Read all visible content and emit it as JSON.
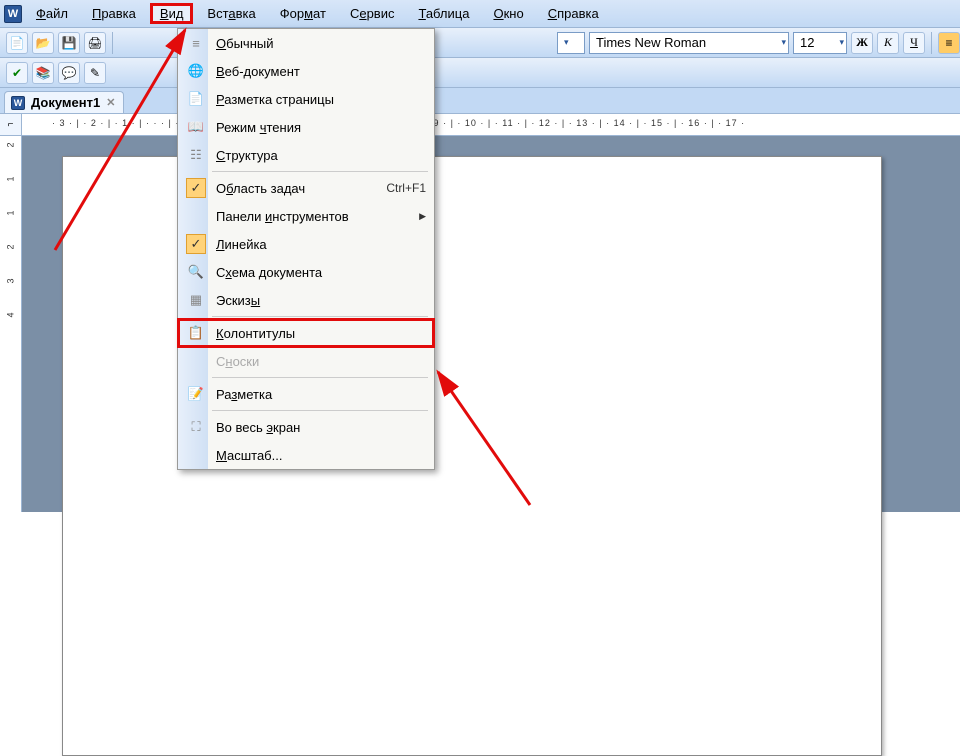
{
  "menubar": {
    "items": [
      {
        "label": "Файл",
        "u": "Ф"
      },
      {
        "label": "Правка",
        "u": "П"
      },
      {
        "label": "Вид",
        "u": "В",
        "highlighted": true
      },
      {
        "label": "Вставка",
        "u": "а"
      },
      {
        "label": "Формат",
        "u": "м"
      },
      {
        "label": "Сервис",
        "u": "е"
      },
      {
        "label": "Таблица",
        "u": "Т"
      },
      {
        "label": "Окно",
        "u": "О"
      },
      {
        "label": "Справка",
        "u": "С"
      }
    ]
  },
  "toolbar": {
    "font_name": "Times New Roman",
    "font_size": "12",
    "bold": "Ж",
    "italic": "К",
    "underline": "Ч"
  },
  "doc_tab": {
    "label": "Документ1"
  },
  "ruler_h": "· 3 · | · 2 · | · 1 · | · · · | · 1 · | · 2 · | · 3 · | · 4 · |                          · 5 · | · 6 · | · 7 · | · 8 · | · 9 · | · 10 · | · 11 · | · 12 · | · 13 · | · 14 · | · 15 · | · 16 · | · 17 ·",
  "ruler_v": [
    "2",
    "1",
    "",
    "1",
    "2",
    "3",
    "4"
  ],
  "view_menu": {
    "items": [
      {
        "icon": "≡",
        "label": "Обычный",
        "u": "О"
      },
      {
        "icon": "🌐",
        "label": "Веб-документ",
        "u": "В"
      },
      {
        "icon": "📄",
        "label": "Разметка страницы",
        "u": "Р"
      },
      {
        "icon": "📖",
        "label": "Режим чтения",
        "u": "ч"
      },
      {
        "icon": "☷",
        "label": "Структура",
        "u": "С"
      },
      {
        "sep": true
      },
      {
        "icon": "✓",
        "checked": true,
        "label": "Область задач",
        "u": "б",
        "shortcut": "Ctrl+F1"
      },
      {
        "icon": "",
        "label": "Панели инструментов",
        "u": "и",
        "sub": "▶"
      },
      {
        "icon": "✓",
        "checked": true,
        "label": "Линейка",
        "u": "Л"
      },
      {
        "icon": "🔍",
        "label": "Схема документа",
        "u": "х"
      },
      {
        "icon": "▦",
        "label": "Эскизы",
        "u": "ы"
      },
      {
        "sep": true
      },
      {
        "icon": "📋",
        "label": "Колонтитулы",
        "u": "К",
        "highlighted": true
      },
      {
        "icon": "",
        "label": "Сноски",
        "u": "н",
        "disabled": true
      },
      {
        "sep": true
      },
      {
        "icon": "📝",
        "label": "Разметка",
        "u": "з"
      },
      {
        "sep": true
      },
      {
        "icon": "⛶",
        "label": "Во весь экран",
        "u": "э"
      },
      {
        "icon": "",
        "label": "Масштаб...",
        "u": "М"
      }
    ]
  }
}
